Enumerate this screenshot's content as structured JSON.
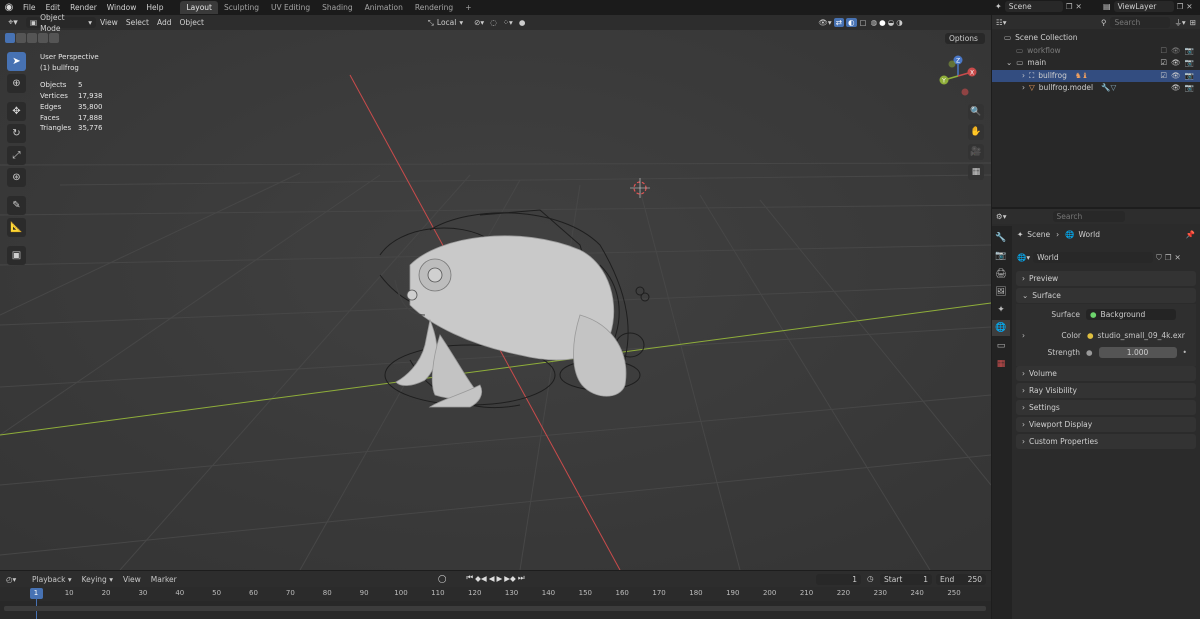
{
  "menu": {
    "items": [
      "File",
      "Edit",
      "Render",
      "Window",
      "Help"
    ],
    "workspaces": [
      "Layout",
      "Sculpting",
      "UV Editing",
      "Shading",
      "Animation",
      "Rendering"
    ],
    "active_workspace": "Layout",
    "add_tab": "+",
    "scene": "Scene",
    "view_layer": "ViewLayer"
  },
  "viewport_header": {
    "mode": "Object Mode",
    "menus": [
      "View",
      "Select",
      "Add",
      "Object"
    ],
    "orientation": "Local",
    "options": "Options"
  },
  "overlay": {
    "perspective": "User Perspective",
    "active_object": "(1) bullfrog",
    "stats": [
      {
        "label": "Objects",
        "value": "5"
      },
      {
        "label": "Vertices",
        "value": "17,938"
      },
      {
        "label": "Edges",
        "value": "35,800"
      },
      {
        "label": "Faces",
        "value": "17,888"
      },
      {
        "label": "Triangles",
        "value": "35,776"
      }
    ]
  },
  "gizmo": {
    "x": "X",
    "y": "Y",
    "z": "Z"
  },
  "outliner": {
    "search_placeholder": "Search",
    "root": "Scene Collection",
    "rows": [
      {
        "label": "workflow",
        "dim": true
      },
      {
        "label": "main",
        "dim": false
      },
      {
        "label": "bullfrog",
        "dim": false,
        "selected": true
      },
      {
        "label": "bullfrog.model",
        "dim": false
      }
    ]
  },
  "properties": {
    "search_placeholder": "Search",
    "breadcrumb": [
      "Scene",
      "World"
    ],
    "world_name": "World",
    "panels": {
      "preview": "Preview",
      "surface": "Surface",
      "volume": "Volume",
      "ray_visibility": "Ray Visibility",
      "settings": "Settings",
      "viewport_display": "Viewport Display",
      "custom_properties": "Custom Properties"
    },
    "surface_label": "Surface",
    "surface_value": "Background",
    "color_label": "Color",
    "color_value": "studio_small_09_4k.exr",
    "strength_label": "Strength",
    "strength_value": "1.000"
  },
  "timeline": {
    "menus": [
      "Playback",
      "Keying",
      "View",
      "Marker"
    ],
    "current_frame": "1",
    "start_label": "Start",
    "start_value": "1",
    "end_label": "End",
    "end_value": "250",
    "ticks": [
      "1",
      "10",
      "20",
      "30",
      "40",
      "50",
      "60",
      "70",
      "80",
      "90",
      "100",
      "110",
      "120",
      "130",
      "140",
      "150",
      "160",
      "170",
      "180",
      "190",
      "200",
      "210",
      "220",
      "230",
      "240",
      "250"
    ]
  },
  "colors": {
    "accent": "#4772b3",
    "selected_row": "#334d80",
    "x_axis": "#c94b4b",
    "y_axis": "#8fae3a"
  }
}
